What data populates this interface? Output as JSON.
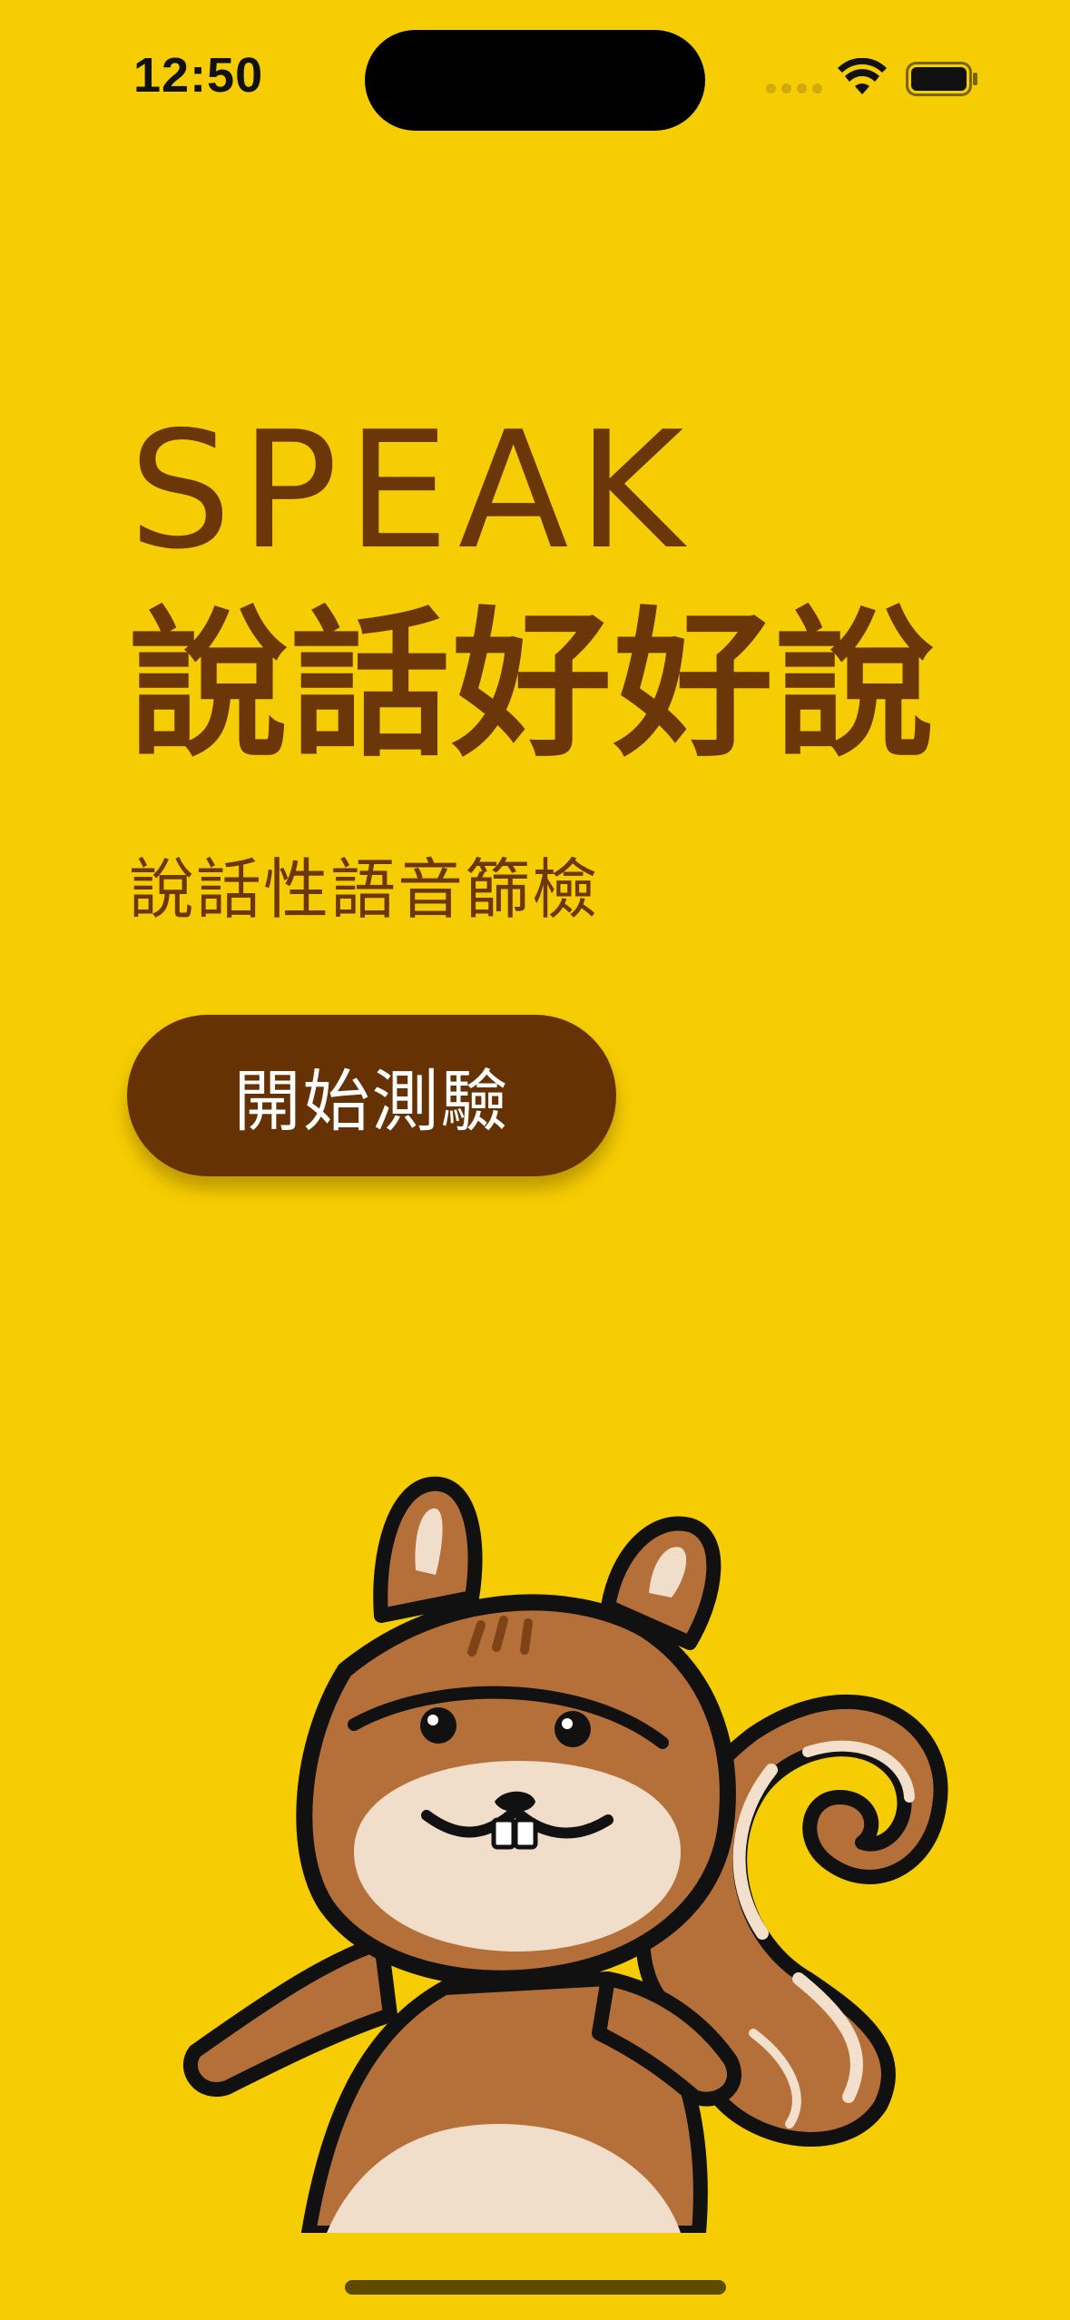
{
  "status_bar": {
    "time": "12:50"
  },
  "hero": {
    "title_en": "SPEAK",
    "title_zh": "說話好好說",
    "subtitle": "說話性語音篩檢"
  },
  "actions": {
    "start_label": "開始測驗"
  },
  "colors": {
    "background": "#F6CD02",
    "text_brown": "#6B3709",
    "button_brown": "#673203",
    "button_text": "#FFFFFF"
  },
  "icons": {
    "wifi": "wifi-icon",
    "battery": "battery-icon",
    "signal": "cellular-signal-icon",
    "mascot": "squirrel-mascot-illustration"
  }
}
